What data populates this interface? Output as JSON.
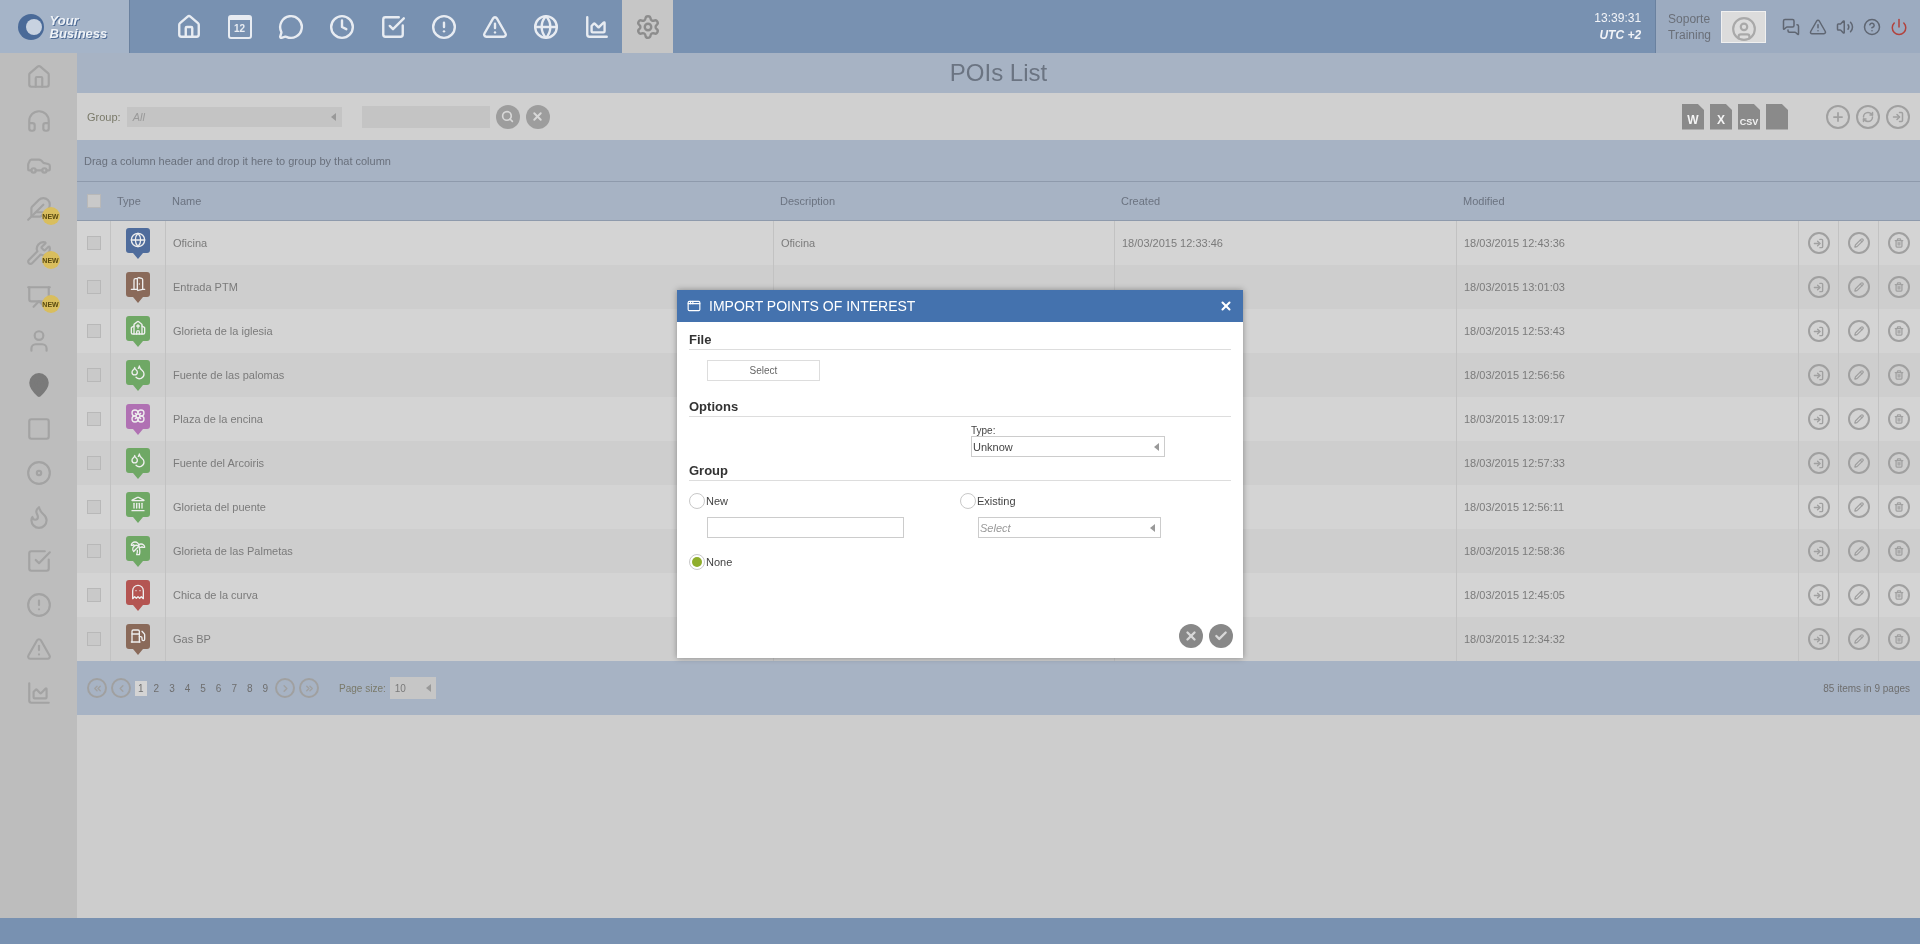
{
  "logo": {
    "text": "Your Business"
  },
  "nav": [
    {
      "selected": false
    },
    {
      "selected": false,
      "text": "12"
    },
    {
      "selected": false
    },
    {
      "selected": false
    },
    {
      "selected": false
    },
    {
      "selected": false
    },
    {
      "selected": false
    },
    {
      "selected": false
    },
    {
      "selected": false
    },
    {
      "selected": true
    }
  ],
  "clock": {
    "time": "13:39:31",
    "zone": "UTC +2"
  },
  "user": {
    "name": "Soporte",
    "role": "Training"
  },
  "sidebar": {
    "items": [
      {
        "selected": false
      },
      {
        "selected": false
      },
      {
        "selected": false
      },
      {
        "selected": false,
        "badge": "NEW"
      },
      {
        "selected": false,
        "badge": "NEW"
      },
      {
        "selected": false,
        "badge": "NEW"
      },
      {
        "selected": false
      },
      {
        "selected": true
      },
      {
        "selected": false
      },
      {
        "selected": false
      },
      {
        "selected": false
      },
      {
        "selected": false
      },
      {
        "selected": false
      },
      {
        "selected": false
      },
      {
        "selected": false
      }
    ]
  },
  "page_title": "POIs List",
  "toolbar": {
    "group_label": "Group:",
    "group_value": "All",
    "exports": [
      {
        "kind": "doc",
        "label": "W"
      },
      {
        "kind": "doc",
        "label": "X"
      },
      {
        "kind": "doc",
        "label": "CSV"
      },
      {
        "kind": "pdf"
      }
    ]
  },
  "group_hint": "Drag a column header and drop it here to group by that column",
  "table": {
    "header_checked": false,
    "columns": [
      "Type",
      "Name",
      "Description",
      "Created",
      "Modified"
    ],
    "rows": [
      {
        "checked": false,
        "color": "#4f6c9c",
        "name": "Oficina",
        "description": "Oficina",
        "created": "18/03/2015 12:33:46",
        "modified": "18/03/2015 12:43:36"
      },
      {
        "checked": false,
        "color": "#8a6a5a",
        "name": "Entrada PTM",
        "modified": "18/03/2015 13:01:03"
      },
      {
        "checked": false,
        "color": "#6fa865",
        "name": "Glorieta de la iglesia",
        "modified": "18/03/2015 12:53:43"
      },
      {
        "checked": false,
        "color": "#6fa865",
        "name": "Fuente de las palomas",
        "modified": "18/03/2015 12:56:56"
      },
      {
        "checked": false,
        "color": "#b071b3",
        "name": "Plaza de la encina",
        "modified": "18/03/2015 13:09:17"
      },
      {
        "checked": false,
        "color": "#6fa865",
        "name": "Fuente del Arcoiris",
        "modified": "18/03/2015 12:57:33"
      },
      {
        "checked": false,
        "color": "#6fa865",
        "name": "Glorieta del puente",
        "modified": "18/03/2015 12:56:11"
      },
      {
        "checked": false,
        "color": "#6fa865",
        "name": "Glorieta de las Palmetas",
        "modified": "18/03/2015 12:58:36"
      },
      {
        "checked": false,
        "color": "#b45552",
        "name": "Chica de la curva",
        "modified": "18/03/2015 12:45:05"
      },
      {
        "checked": false,
        "color": "#8a6a5a",
        "name": "Gas BP",
        "modified": "18/03/2015 12:34:32"
      }
    ]
  },
  "pager": {
    "pages": [
      {
        "label": "1",
        "selected": true
      },
      {
        "label": "2",
        "selected": false
      },
      {
        "label": "3",
        "selected": false
      },
      {
        "label": "4",
        "selected": false
      },
      {
        "label": "5",
        "selected": false
      },
      {
        "label": "6",
        "selected": false
      },
      {
        "label": "7",
        "selected": false
      },
      {
        "label": "8",
        "selected": false
      },
      {
        "label": "9",
        "selected": false
      }
    ],
    "page_size_label": "Page size:",
    "page_size": "10",
    "summary": "85 items in 9 pages"
  },
  "dialog": {
    "title": "IMPORT POINTS OF INTEREST",
    "file_heading": "File",
    "select_button": "Select",
    "options_heading": "Options",
    "type_label": "Type:",
    "type_value": "Unknow",
    "group_heading": "Group",
    "radios": [
      {
        "label": "New",
        "selected": false
      },
      {
        "label": "Existing",
        "selected": false
      },
      {
        "label": "None",
        "selected": true
      }
    ],
    "existing_placeholder": "Select"
  }
}
